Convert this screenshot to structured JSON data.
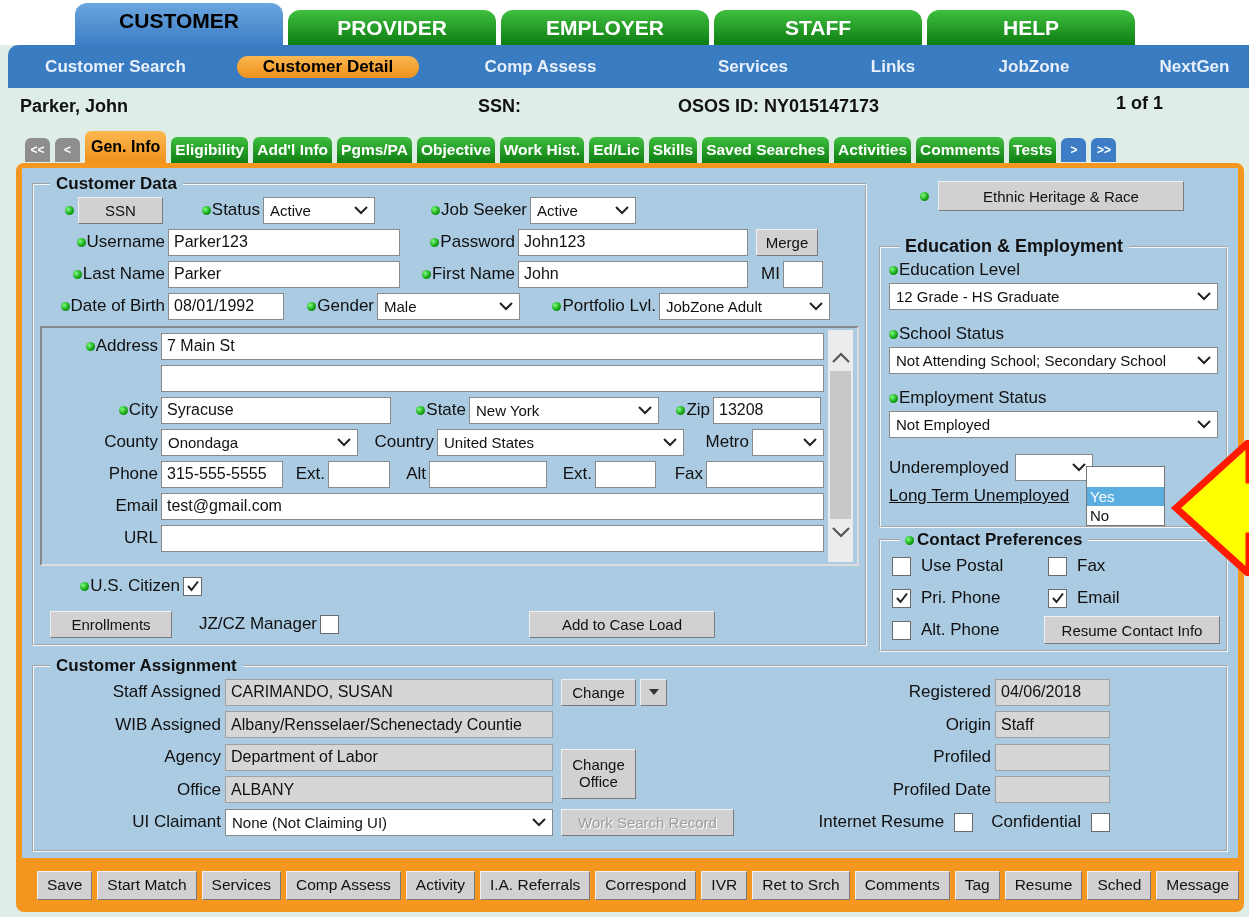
{
  "top_tabs": [
    {
      "label": "CUSTOMER",
      "selected": true
    },
    {
      "label": "PROVIDER",
      "selected": false
    },
    {
      "label": "EMPLOYER",
      "selected": false
    },
    {
      "label": "STAFF",
      "selected": false
    },
    {
      "label": "HELP",
      "selected": false
    }
  ],
  "nav": [
    {
      "label": "Customer Search",
      "selected": false
    },
    {
      "label": "Customer Detail",
      "selected": true
    },
    {
      "label": "Comp Assess",
      "selected": false
    },
    {
      "label": "Services",
      "selected": false
    },
    {
      "label": "Links",
      "selected": false
    },
    {
      "label": "JobZone",
      "selected": false
    },
    {
      "label": "NextGen",
      "selected": false
    }
  ],
  "record": {
    "name": "Parker, John",
    "ssn_label": "SSN:",
    "osos_id": "OSOS ID: NY015147173",
    "position": "1 of 1"
  },
  "tab_scroll": {
    "first": "<<",
    "previous": "<",
    "next": ">",
    "last": ">>"
  },
  "detail_tabs": [
    {
      "label": "Gen. Info",
      "selected": true
    },
    {
      "label": "Eligibility",
      "selected": false
    },
    {
      "label": "Add'l Info",
      "selected": false
    },
    {
      "label": "Pgms/PA",
      "selected": false
    },
    {
      "label": "Objective",
      "selected": false
    },
    {
      "label": "Work Hist.",
      "selected": false
    },
    {
      "label": "Ed/Lic",
      "selected": false
    },
    {
      "label": "Skills",
      "selected": false
    },
    {
      "label": "Saved Searches",
      "selected": false
    },
    {
      "label": "Activities",
      "selected": false
    },
    {
      "label": "Comments",
      "selected": false
    },
    {
      "label": "Tests",
      "selected": false
    }
  ],
  "customer_data": {
    "title": "Customer Data",
    "lines": [
      [
        {
          "kind": "button",
          "label": "SSN",
          "required": true
        },
        {
          "kind": "select",
          "label": "Status",
          "required": true,
          "value": "Active"
        },
        {
          "kind": "select",
          "label": "Job Seeker",
          "required": true,
          "value": "Active"
        }
      ],
      [
        {
          "kind": "text",
          "label": "Username",
          "required": true,
          "value": "Parker123"
        },
        {
          "kind": "text",
          "label": "Password",
          "required": true,
          "value": "John123"
        },
        {
          "kind": "button",
          "label": "Merge"
        }
      ],
      [
        {
          "kind": "text",
          "label": "Last Name",
          "required": true,
          "value": "Parker"
        },
        {
          "kind": "text",
          "label": "First Name",
          "required": true,
          "value": "John"
        },
        {
          "kind": "text",
          "label": "MI"
        }
      ],
      [
        {
          "kind": "text",
          "label": "Date of Birth",
          "required": true,
          "value": "08/01/1992"
        },
        {
          "kind": "select",
          "label": "Gender",
          "required": true,
          "value": "Male"
        },
        {
          "kind": "select",
          "label": "Portfolio Lvl.",
          "required": true,
          "value": "JobZone Adult"
        }
      ]
    ],
    "address_lines": [
      [
        {
          "kind": "text",
          "label": "Address",
          "required": true,
          "value": "7 Main St"
        }
      ],
      [
        {
          "kind": "text"
        }
      ],
      [
        {
          "kind": "text",
          "label": "City",
          "required": true,
          "value": "Syracuse"
        },
        {
          "kind": "select",
          "label": "State",
          "required": true,
          "value": "New York"
        },
        {
          "kind": "text",
          "label": "Zip",
          "required": true,
          "value": "13208"
        }
      ],
      [
        {
          "kind": "select",
          "label": "County",
          "value": "Onondaga"
        },
        {
          "kind": "select",
          "label": "Country",
          "value": "United States"
        },
        {
          "kind": "select",
          "label": "Metro"
        }
      ],
      [
        {
          "kind": "text",
          "label": "Phone",
          "value": "315-555-5555"
        },
        {
          "kind": "text",
          "label": "Ext."
        },
        {
          "kind": "text",
          "label": "Alt"
        },
        {
          "kind": "text",
          "label": "Ext."
        },
        {
          "kind": "text",
          "label": "Fax"
        }
      ],
      [
        {
          "kind": "text",
          "label": "Email",
          "value": "test@gmail.com"
        }
      ],
      [
        {
          "kind": "text",
          "label": "URL"
        }
      ]
    ],
    "bottom_lines": [
      [
        {
          "kind": "check",
          "label": "U.S. Citizen",
          "required": true,
          "checked": true
        }
      ],
      [
        {
          "kind": "button",
          "label": "Enrollments"
        },
        {
          "kind": "check",
          "label": "JZ/CZ Manager",
          "checked": false
        },
        {
          "kind": "button",
          "label": "Add to Case Load"
        }
      ]
    ]
  },
  "ethnic": {
    "label": "Ethnic Heritage & Race",
    "required": true
  },
  "education": {
    "title": "Education & Employment",
    "selects": [
      {
        "label": "Education Level",
        "required": true,
        "value": "12 Grade - HS Graduate"
      },
      {
        "label": "School Status",
        "required": true,
        "value": "Not Attending School; Secondary School"
      },
      {
        "label": "Employment Status",
        "required": true,
        "value": "Not Employed"
      }
    ],
    "underemployed": {
      "label": "Underemployed",
      "expanded": true,
      "options": [
        {
          "label": "Yes",
          "selected": true
        },
        {
          "label": "No",
          "selected": false
        }
      ]
    },
    "long_term_link": "Long Term Unemployed"
  },
  "contact": {
    "title": "Contact Preferences",
    "required": true,
    "options": [
      {
        "label": "Use Postal",
        "checked": false
      },
      {
        "label": "Fax",
        "checked": false
      },
      {
        "label": "Pri. Phone",
        "checked": true
      },
      {
        "label": "Email",
        "checked": true
      },
      {
        "label": "Alt. Phone",
        "checked": false
      }
    ],
    "button": "Resume Contact Info"
  },
  "assignment": {
    "title": "Customer Assignment",
    "fields": [
      {
        "kind": "readonly",
        "label": "Staff Assigned",
        "value": "CARIMANDO, SUSAN"
      },
      {
        "kind": "readonly",
        "label": "WIB Assigned",
        "value": "Albany/Rensselaer/Schenectady Countie"
      },
      {
        "kind": "readonly",
        "label": "Agency",
        "value": "Department of Labor"
      },
      {
        "kind": "readonly",
        "label": "Office",
        "value": "ALBANY"
      },
      {
        "kind": "select",
        "label": "UI Claimant",
        "value": "None (Not Claiming UI)"
      }
    ],
    "change_button": "Change",
    "change_office_button": "Change Office",
    "work_search_button": {
      "label": "Work Search Record",
      "disabled": true
    },
    "right_fields": [
      {
        "label": "Registered",
        "value": "04/06/2018"
      },
      {
        "label": "Origin",
        "value": "Staff"
      },
      {
        "label": "Profiled"
      },
      {
        "label": "Profiled Date"
      }
    ],
    "checks": [
      {
        "label": "Internet Resume",
        "checked": false
      },
      {
        "label": "Confidential",
        "checked": false
      }
    ]
  },
  "toolbar": [
    "Save",
    "Start Match",
    "Services",
    "Comp Assess",
    "Activity",
    "I.A. Referrals",
    "Correspond",
    "IVR",
    "Ret to Srch",
    "Comments",
    "Tag",
    "Resume",
    "Sched",
    "Message"
  ]
}
